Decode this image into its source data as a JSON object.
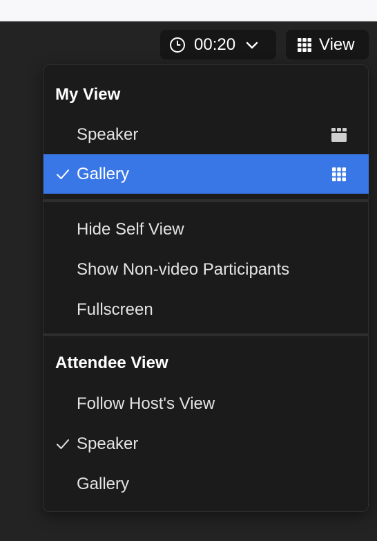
{
  "toolbar": {
    "timer_value": "00:20",
    "view_label": "View"
  },
  "menu": {
    "my_view_title": "My View",
    "my_view_items": [
      {
        "label": "Speaker",
        "checked": false,
        "icon": "speaker-layout-icon"
      },
      {
        "label": "Gallery",
        "checked": true,
        "icon": "gallery-grid-icon"
      }
    ],
    "options": [
      {
        "label": "Hide Self View"
      },
      {
        "label": "Show Non-video Participants"
      },
      {
        "label": "Fullscreen"
      }
    ],
    "attendee_view_title": "Attendee View",
    "attendee_items": [
      {
        "label": "Follow Host's View",
        "checked": false
      },
      {
        "label": "Speaker",
        "checked": true
      },
      {
        "label": "Gallery",
        "checked": false
      }
    ]
  },
  "colors": {
    "selected_bg": "#3a77e6",
    "menu_bg": "#1b1b1b",
    "app_bg": "#232323"
  }
}
